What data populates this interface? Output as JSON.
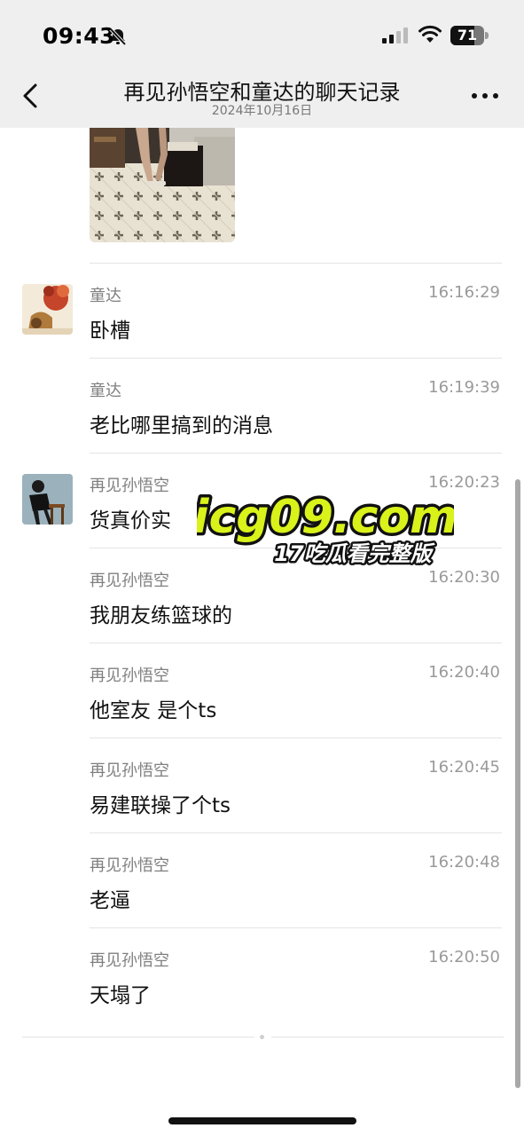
{
  "status_bar": {
    "time": "09:43",
    "battery": "71",
    "battery_level_percent": 71,
    "icons": [
      "bell-slash-icon",
      "cellular-signal-icon",
      "wifi-icon",
      "battery-icon"
    ]
  },
  "header": {
    "title": "再见孙悟空和童达的聊天记录",
    "date": "2024年10月16日",
    "icons": [
      "chevron-left-icon",
      "more-icon"
    ]
  },
  "watermark": {
    "domain": "icg09.com",
    "tagline": "17吃瓜看完整版",
    "colors": {
      "domain_fill": "#d9f21a",
      "tagline_fill": "#ffffff",
      "outline": "#111111"
    }
  },
  "messages": [
    {
      "sender": "童达",
      "time": "16:16:29",
      "text": "卧槽",
      "avatar": "tongda-avatar"
    },
    {
      "sender": "童达",
      "time": "16:19:39",
      "text": "老比哪里搞到的消息"
    },
    {
      "sender": "再见孙悟空",
      "time": "16:20:23",
      "text": "货真价实",
      "avatar": "sunwukong-avatar"
    },
    {
      "sender": "再见孙悟空",
      "time": "16:20:30",
      "text": "我朋友练篮球的"
    },
    {
      "sender": "再见孙悟空",
      "time": "16:20:40",
      "text": "他室友 是个ts"
    },
    {
      "sender": "再见孙悟空",
      "time": "16:20:45",
      "text": "易建联操了个ts"
    },
    {
      "sender": "再见孙悟空",
      "time": "16:20:48",
      "text": "老逼"
    },
    {
      "sender": "再见孙悟空",
      "time": "16:20:50",
      "text": "天塌了"
    }
  ]
}
